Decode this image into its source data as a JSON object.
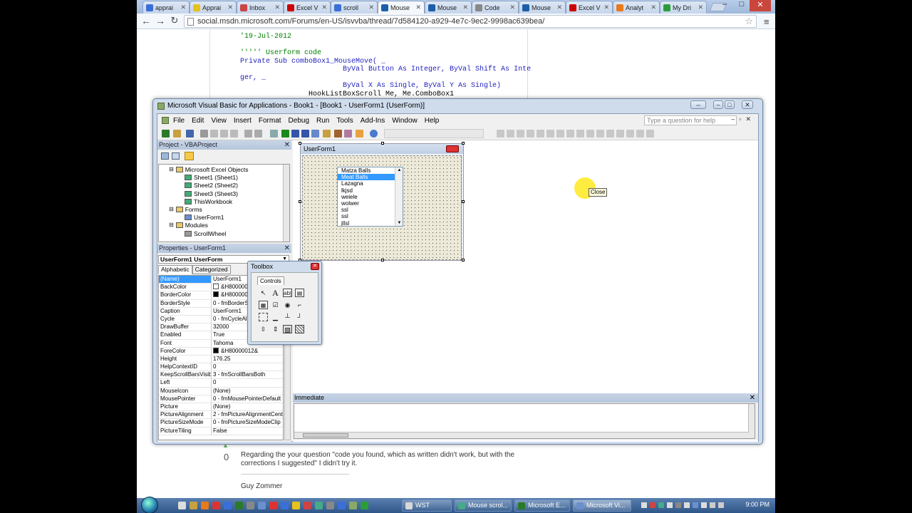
{
  "browser": {
    "tabs": [
      {
        "label": "apprai",
        "fav": "#3b6fd8",
        "active": false
      },
      {
        "label": "Apprai",
        "fav": "#e8c21b",
        "active": false
      },
      {
        "label": "Inbox",
        "fav": "#c44",
        "active": false
      },
      {
        "label": "Excel V",
        "fav": "#c00",
        "active": false
      },
      {
        "label": "scroll",
        "fav": "#3b6fd8",
        "active": false
      },
      {
        "label": "Mouse",
        "fav": "#1b5fa8",
        "active": true
      },
      {
        "label": "Mouse",
        "fav": "#1b5fa8",
        "active": false
      },
      {
        "label": "Code",
        "fav": "#888",
        "active": false
      },
      {
        "label": "Mouse",
        "fav": "#1b5fa8",
        "active": false
      },
      {
        "label": "Excel V",
        "fav": "#c00",
        "active": false
      },
      {
        "label": "Analyt",
        "fav": "#e87a1b",
        "active": false
      },
      {
        "label": "My Dri",
        "fav": "#2a9d3a",
        "active": false
      }
    ],
    "url": "social.msdn.microsoft.com/Forums/en-US/isvvba/thread/7d584120-a929-4e7c-9ec2-9998ac639bea/"
  },
  "page": {
    "code_lines": [
      {
        "text": "'19-Jul-2012",
        "cls": "c-green"
      },
      {
        "text": "",
        "cls": "c-black"
      },
      {
        "text": "''''' Userform code",
        "cls": "c-green"
      },
      {
        "text": "Private Sub comboBox1_MouseMove( _",
        "cls": "c-blue"
      },
      {
        "text": "                        ByVal Button As Integer, ByVal Shift As Inte",
        "cls": "c-blue"
      },
      {
        "text": "ger, _",
        "cls": "c-blue"
      },
      {
        "text": "                        ByVal X As Single, ByVal Y As Single)",
        "cls": "c-blue"
      },
      {
        "text": "                HookListBoxScroll Me, Me.ComboBox1",
        "cls": "c-black"
      }
    ],
    "vote": "0",
    "reply_line1": "Regarding the your question \"code you found, which as written didn't work, but with the",
    "reply_line2": "corrections I suggested\" I didn't try it.",
    "author": "Guy Zommer"
  },
  "vbe": {
    "title": "Microsoft Visual Basic for Applications - Book1 - [Book1 - UserForm1 (UserForm)]",
    "menu": [
      "File",
      "Edit",
      "View",
      "Insert",
      "Format",
      "Debug",
      "Run",
      "Tools",
      "Add-Ins",
      "Window",
      "Help"
    ],
    "help_placeholder": "Type a question for help",
    "project": {
      "title": "Project - VBAProject",
      "nodes": [
        {
          "label": "Microsoft Excel Objects",
          "level": 1,
          "icon": "#e8c86a"
        },
        {
          "label": "Sheet1 (Sheet1)",
          "level": 2,
          "icon": "#4a7"
        },
        {
          "label": "Sheet2 (Sheet2)",
          "level": 2,
          "icon": "#4a7"
        },
        {
          "label": "Sheet3 (Sheet3)",
          "level": 2,
          "icon": "#4a7"
        },
        {
          "label": "ThisWorkbook",
          "level": 2,
          "icon": "#4a7"
        },
        {
          "label": "Forms",
          "level": 1,
          "icon": "#e8c86a"
        },
        {
          "label": "UserForm1",
          "level": 2,
          "icon": "#6a8fd0"
        },
        {
          "label": "Modules",
          "level": 1,
          "icon": "#e8c86a"
        },
        {
          "label": "ScrollWheel",
          "level": 2,
          "icon": "#999"
        }
      ]
    },
    "properties": {
      "title": "Properties - UserForm1",
      "object": "UserForm1 UserForm",
      "tab_alpha": "Alphabetic",
      "tab_cat": "Categorized",
      "rows": [
        {
          "k": "(Name)",
          "v": "UserForm1",
          "sw": ""
        },
        {
          "k": "BackColor",
          "v": "&H8000000",
          "sw": "#ffffff"
        },
        {
          "k": "BorderColor",
          "v": "&H8000000",
          "sw": "#000000"
        },
        {
          "k": "BorderStyle",
          "v": "0 - fmBorderSt",
          "sw": ""
        },
        {
          "k": "Caption",
          "v": "UserForm1",
          "sw": ""
        },
        {
          "k": "Cycle",
          "v": "0 - fmCycleAllF",
          "sw": ""
        },
        {
          "k": "DrawBuffer",
          "v": "32000",
          "sw": ""
        },
        {
          "k": "Enabled",
          "v": "True",
          "sw": ""
        },
        {
          "k": "Font",
          "v": "Tahoma",
          "sw": ""
        },
        {
          "k": "ForeColor",
          "v": "&H80000012&",
          "sw": "#000000"
        },
        {
          "k": "Height",
          "v": "176.25",
          "sw": ""
        },
        {
          "k": "HelpContextID",
          "v": "0",
          "sw": ""
        },
        {
          "k": "KeepScrollBarsVisible",
          "v": "3 - fmScrollBarsBoth",
          "sw": ""
        },
        {
          "k": "Left",
          "v": "0",
          "sw": ""
        },
        {
          "k": "MouseIcon",
          "v": "(None)",
          "sw": ""
        },
        {
          "k": "MousePointer",
          "v": "0 - fmMousePointerDefault",
          "sw": ""
        },
        {
          "k": "Picture",
          "v": "(None)",
          "sw": ""
        },
        {
          "k": "PictureAlignment",
          "v": "2 - fmPictureAlignmentCent",
          "sw": ""
        },
        {
          "k": "PictureSizeMode",
          "v": "0 - fmPictureSizeModeClip",
          "sw": ""
        },
        {
          "k": "PictureTiling",
          "v": "False",
          "sw": ""
        }
      ]
    },
    "userform": {
      "title": "UserForm1",
      "list_items": [
        "Matza Balls",
        "Meat Balls",
        "Lazagna",
        "lkjsd",
        "weiele",
        "wolwer",
        "ssl",
        "ssl",
        "jllsl"
      ],
      "selected_index": 1,
      "tooltip": "Close"
    },
    "toolbox": {
      "title": "Toolbox",
      "tab": "Controls"
    },
    "immediate_title": "Immediate"
  },
  "taskbar": {
    "tasks": [
      {
        "label": "WST",
        "color": "#d8d8d8",
        "active": false
      },
      {
        "label": "Mouse scrol...",
        "color": "#4a8",
        "active": false
      },
      {
        "label": "Microsoft E...",
        "color": "#2a7a2a",
        "active": false
      },
      {
        "label": "Microsoft Vi...",
        "color": "#6a8fd0",
        "active": true
      }
    ],
    "clock": "9:00 PM"
  }
}
